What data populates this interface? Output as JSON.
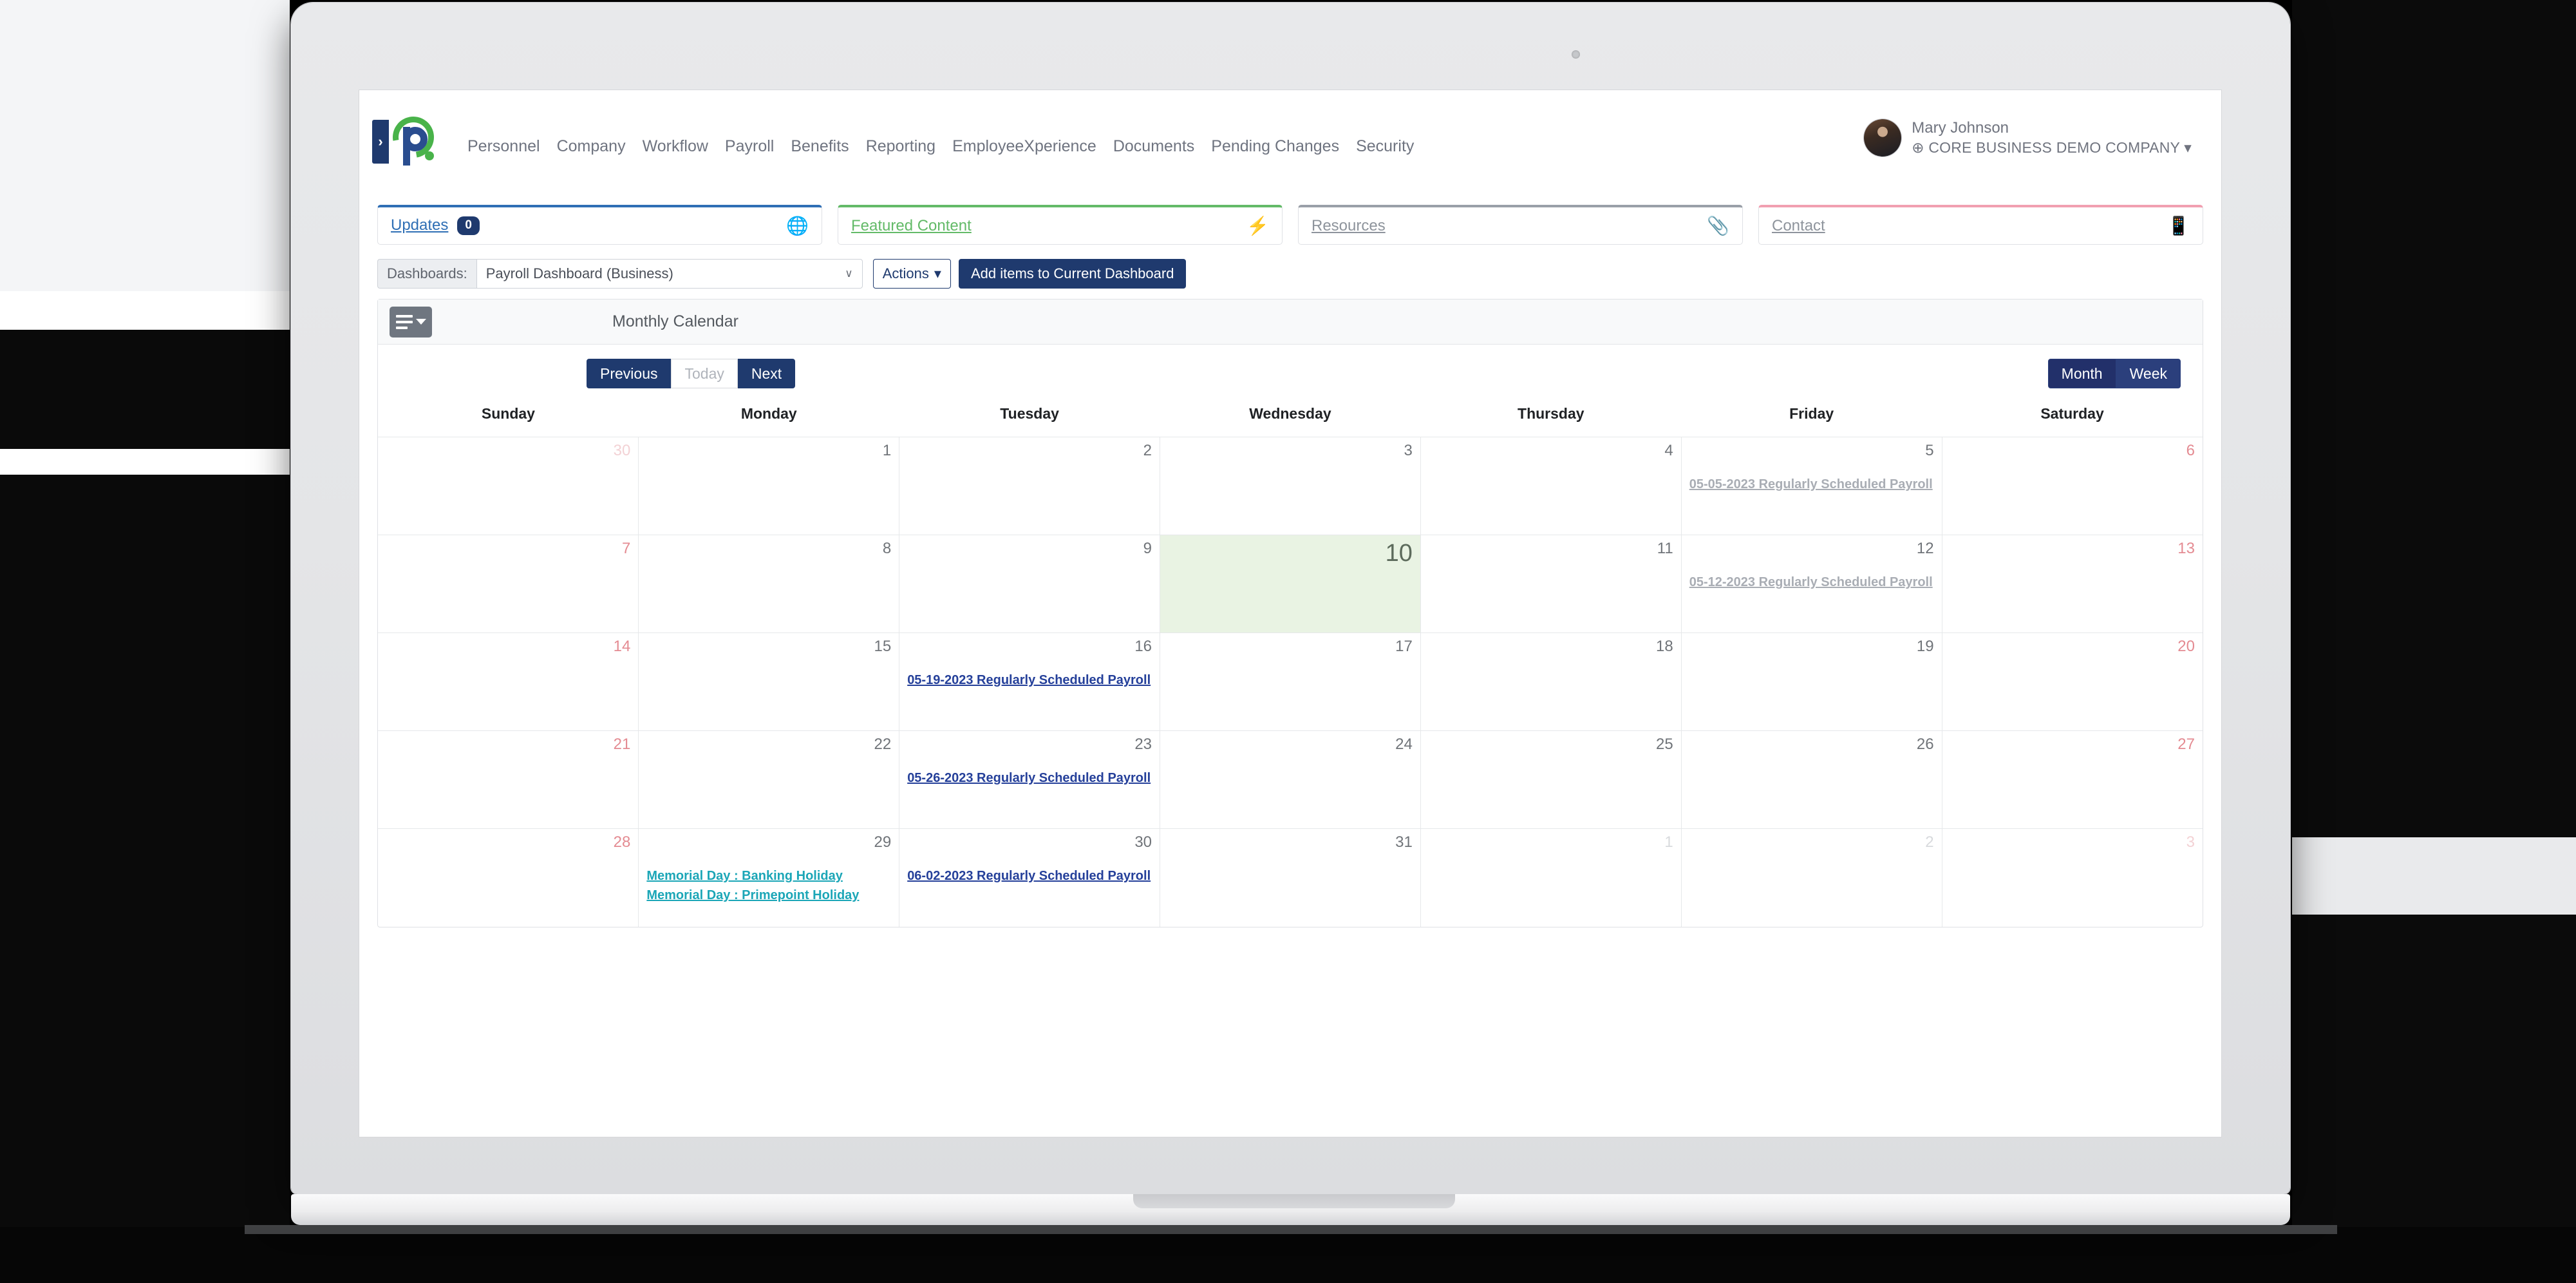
{
  "app": {
    "logo_letter": "P",
    "logo_chevron": "›"
  },
  "nav": {
    "items": [
      {
        "label": "Personnel"
      },
      {
        "label": "Company"
      },
      {
        "label": "Workflow"
      },
      {
        "label": "Payroll"
      },
      {
        "label": "Benefits"
      },
      {
        "label": "Reporting"
      },
      {
        "label": "EmployeeXperience"
      },
      {
        "label": "Documents"
      },
      {
        "label": "Pending Changes"
      },
      {
        "label": "Security"
      }
    ]
  },
  "user": {
    "name": "Mary Johnson",
    "company": "⊕ CORE BUSINESS DEMO COMPANY",
    "caret": "▾"
  },
  "panels": [
    {
      "label": "Updates",
      "badge": "0",
      "icon": "🌐",
      "icon_name": "globe-icon",
      "accent": "#2f6fb5"
    },
    {
      "label": "Featured Content",
      "badge": "",
      "icon": "⚡",
      "icon_name": "lightning-icon",
      "accent": "#63ba68"
    },
    {
      "label": "Resources",
      "badge": "",
      "icon": "📎",
      "icon_name": "paperclip-icon",
      "accent": "#9aa0a8"
    },
    {
      "label": "Contact",
      "badge": "",
      "icon": "📱",
      "icon_name": "mobile-icon",
      "accent": "#f1a0b1"
    }
  ],
  "toolbar": {
    "dashboards_label": "Dashboards:",
    "selected_dashboard": "Payroll Dashboard (Business)",
    "select_caret": "∨",
    "actions_label": "Actions",
    "actions_caret": "▾",
    "add_items_label": "Add items to Current Dashboard"
  },
  "widget": {
    "title": "Monthly Calendar",
    "menu_icon_name": "list-menu-icon"
  },
  "calendar": {
    "controls": {
      "previous": "Previous",
      "today": "Today",
      "next": "Next",
      "month": "Month",
      "week": "Week",
      "active_view": "Month"
    },
    "day_headers": [
      "Sunday",
      "Monday",
      "Tuesday",
      "Wednesday",
      "Thursday",
      "Friday",
      "Saturday"
    ],
    "weeks": [
      [
        {
          "num": "30",
          "muted": true,
          "weekend": true,
          "today": false,
          "events": []
        },
        {
          "num": "1",
          "muted": false,
          "weekend": false,
          "today": false,
          "events": []
        },
        {
          "num": "2",
          "muted": false,
          "weekend": false,
          "today": false,
          "events": []
        },
        {
          "num": "3",
          "muted": false,
          "weekend": false,
          "today": false,
          "events": []
        },
        {
          "num": "4",
          "muted": false,
          "weekend": false,
          "today": false,
          "events": []
        },
        {
          "num": "5",
          "muted": false,
          "weekend": false,
          "today": false,
          "events": [
            {
              "text": "05-05-2023 Regularly Scheduled Payroll",
              "style": "past"
            }
          ]
        },
        {
          "num": "6",
          "muted": false,
          "weekend": true,
          "today": false,
          "events": []
        }
      ],
      [
        {
          "num": "7",
          "muted": false,
          "weekend": true,
          "today": false,
          "events": []
        },
        {
          "num": "8",
          "muted": false,
          "weekend": false,
          "today": false,
          "events": []
        },
        {
          "num": "9",
          "muted": false,
          "weekend": false,
          "today": false,
          "events": []
        },
        {
          "num": "10",
          "muted": false,
          "weekend": false,
          "today": true,
          "events": []
        },
        {
          "num": "11",
          "muted": false,
          "weekend": false,
          "today": false,
          "events": []
        },
        {
          "num": "12",
          "muted": false,
          "weekend": false,
          "today": false,
          "events": [
            {
              "text": "05-12-2023 Regularly Scheduled Payroll",
              "style": "past"
            }
          ]
        },
        {
          "num": "13",
          "muted": false,
          "weekend": true,
          "today": false,
          "events": []
        }
      ],
      [
        {
          "num": "14",
          "muted": false,
          "weekend": true,
          "today": false,
          "events": []
        },
        {
          "num": "15",
          "muted": false,
          "weekend": false,
          "today": false,
          "events": []
        },
        {
          "num": "16",
          "muted": false,
          "weekend": false,
          "today": false,
          "events": [
            {
              "text": "05-19-2023 Regularly Scheduled Payroll",
              "style": "future"
            }
          ]
        },
        {
          "num": "17",
          "muted": false,
          "weekend": false,
          "today": false,
          "events": []
        },
        {
          "num": "18",
          "muted": false,
          "weekend": false,
          "today": false,
          "events": []
        },
        {
          "num": "19",
          "muted": false,
          "weekend": false,
          "today": false,
          "events": []
        },
        {
          "num": "20",
          "muted": false,
          "weekend": true,
          "today": false,
          "events": []
        }
      ],
      [
        {
          "num": "21",
          "muted": false,
          "weekend": true,
          "today": false,
          "events": []
        },
        {
          "num": "22",
          "muted": false,
          "weekend": false,
          "today": false,
          "events": []
        },
        {
          "num": "23",
          "muted": false,
          "weekend": false,
          "today": false,
          "events": [
            {
              "text": "05-26-2023 Regularly Scheduled Payroll",
              "style": "future"
            }
          ]
        },
        {
          "num": "24",
          "muted": false,
          "weekend": false,
          "today": false,
          "events": []
        },
        {
          "num": "25",
          "muted": false,
          "weekend": false,
          "today": false,
          "events": []
        },
        {
          "num": "26",
          "muted": false,
          "weekend": false,
          "today": false,
          "events": []
        },
        {
          "num": "27",
          "muted": false,
          "weekend": true,
          "today": false,
          "events": []
        }
      ],
      [
        {
          "num": "28",
          "muted": false,
          "weekend": true,
          "today": false,
          "events": []
        },
        {
          "num": "29",
          "muted": false,
          "weekend": false,
          "today": false,
          "events": [
            {
              "text": "Memorial Day : Banking Holiday",
              "style": "holiday"
            },
            {
              "text": "Memorial Day : Primepoint Holiday",
              "style": "holiday"
            }
          ]
        },
        {
          "num": "30",
          "muted": false,
          "weekend": false,
          "today": false,
          "events": [
            {
              "text": "06-02-2023 Regularly Scheduled Payroll",
              "style": "future"
            }
          ]
        },
        {
          "num": "31",
          "muted": false,
          "weekend": false,
          "today": false,
          "events": []
        },
        {
          "num": "1",
          "muted": true,
          "weekend": false,
          "today": false,
          "events": []
        },
        {
          "num": "2",
          "muted": true,
          "weekend": false,
          "today": false,
          "events": []
        },
        {
          "num": "3",
          "muted": true,
          "weekend": true,
          "today": false,
          "events": []
        }
      ]
    ]
  }
}
